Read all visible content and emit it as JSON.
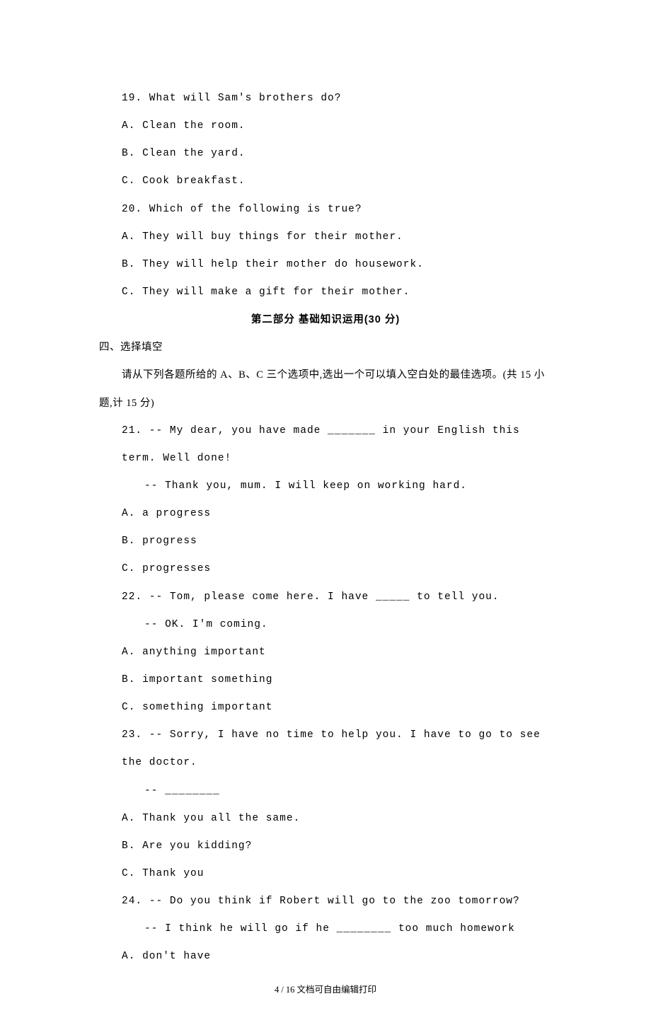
{
  "q19": {
    "stem": "19. What will Sam's brothers do?",
    "a": "A. Clean the room.",
    "b": "B. Clean the yard.",
    "c": "C. Cook breakfast."
  },
  "q20": {
    "stem": "20. Which of the following is true?",
    "a": "A. They will buy things for their mother.",
    "b": "B. They will help their mother do housework.",
    "c": "C. They will make a gift for their mother."
  },
  "section_title": "第二部分  基础知识运用(30 分)",
  "sec4_heading": "四、选择填空",
  "sec4_instr": "请从下列各题所给的 A、B、C 三个选项中,选出一个可以填入空白处的最佳选项。(共 15 小题,计 15 分)",
  "q21": {
    "line1": "21. -- My dear, you have made _______ in your English this term. Well done!",
    "line2": "-- Thank you, mum. I will keep on working hard.",
    "a": "A. a progress",
    "b": "B. progress",
    "c": "C. progresses"
  },
  "q22": {
    "line1": "22. -- Tom, please come here. I have _____ to tell you.",
    "line2": "-- OK. I'm coming.",
    "a": "A. anything important",
    "b": "B. important something",
    "c": "C. something important"
  },
  "q23": {
    "line1": "23. -- Sorry, I have no time to help you. I have to go to see the doctor.",
    "line2": "-- ________",
    "a": "A. Thank you all the same.",
    "b": "B. Are you kidding?",
    "c": "C. Thank you"
  },
  "q24": {
    "line1": "24. -- Do you think if Robert will go to the zoo tomorrow?",
    "line2": "-- I think he will go if he ________ too much homework",
    "a": "A. don't have"
  },
  "footer": "4 / 16 文档可自由编辑打印"
}
